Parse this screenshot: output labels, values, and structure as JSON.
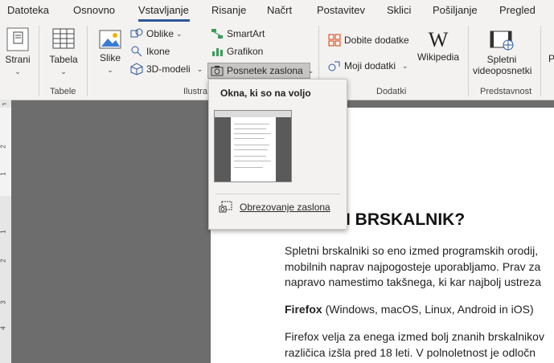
{
  "tabs": [
    "Datoteka",
    "Osnovno",
    "Vstavljanje",
    "Risanje",
    "Načrt",
    "Postavitev",
    "Sklici",
    "Pošiljanje",
    "Pregled"
  ],
  "ribbon": {
    "pages_label": "Strani",
    "table_label": "Tabela",
    "tables_group": "Tabele",
    "pictures_label": "Slike",
    "shapes_label": "Oblike",
    "icons_label": "Ikone",
    "models_label": "3D-modeli",
    "smartart_label": "SmartArt",
    "chart_label": "Grafikon",
    "screenshot_label": "Posnetek zaslona",
    "illustrations_group": "Ilustra",
    "addins_get_label": "Dobite dodatke",
    "my_addins_label": "Moji dodatki",
    "wikipedia_label": "Wikipedia",
    "addins_group": "Dodatki",
    "online_video_label_1": "Spletni",
    "online_video_label_2": "videoposnetki",
    "media_group": "Predstavnost"
  },
  "dropdown": {
    "title": "Okna, ki so na voljo",
    "clip_label": "Obrezovanje zaslona"
  },
  "document": {
    "heading": "I BRSKALNIK?",
    "p1_l1": "Spletni brskalniki so eno izmed programskih orodij,",
    "p1_l2": "mobilnih naprav najpogosteje uporabljamo. Prav za",
    "p1_l3": "napravo namestimo takšnega, ki kar najbolj ustreza",
    "firefox_bold": "Firefox",
    "firefox_rest": " (Windows, macOS, Linux, Android in iOS)",
    "p2_l1": "Firefox velja za enega izmed bolj znanih brskalnikov",
    "p2_l2": "različica izšla pred 18 leti. V polnoletnost je odločn"
  },
  "ruler": [
    "2",
    "1",
    "1",
    "2",
    "3",
    "4"
  ]
}
